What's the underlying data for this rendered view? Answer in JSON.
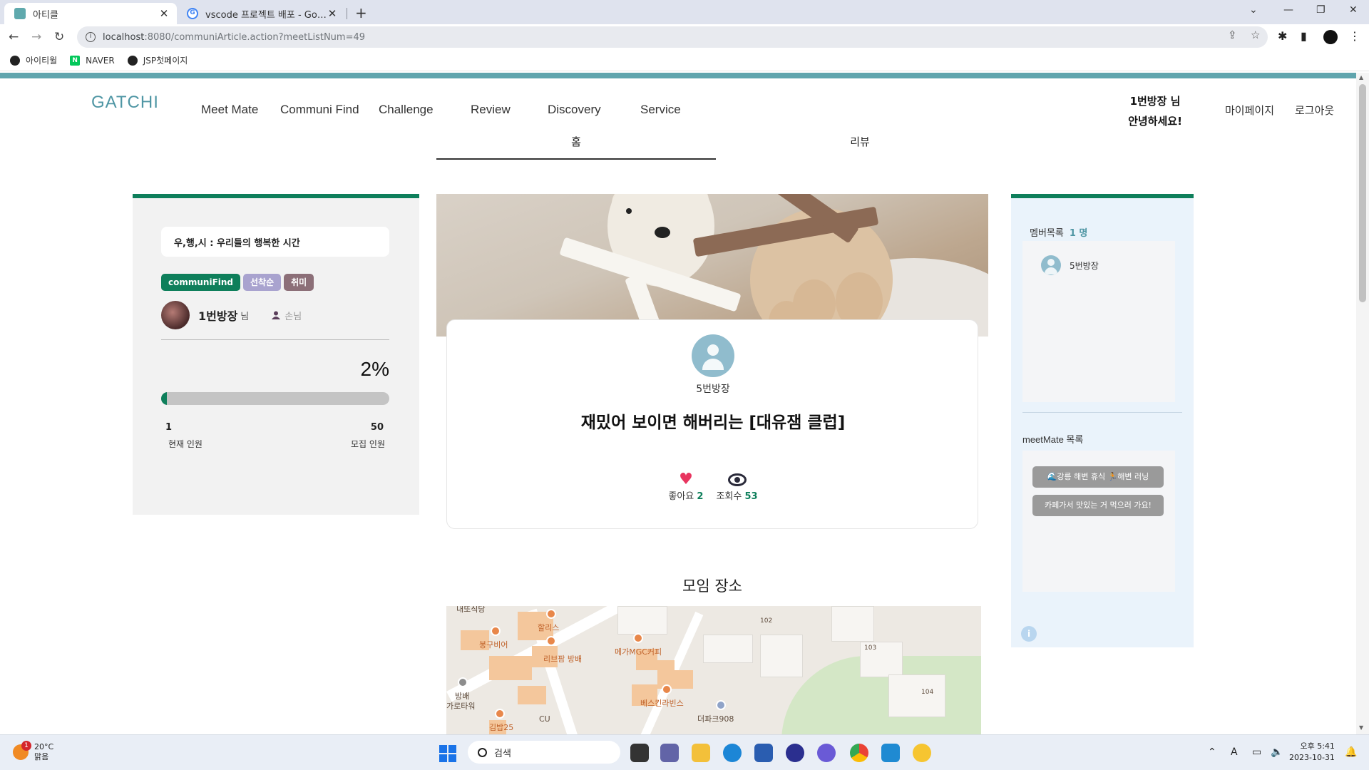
{
  "browser": {
    "tabs": [
      {
        "title": "아티클",
        "active": true
      },
      {
        "title": "vscode 프로젝트 배포 - Google",
        "active": false
      }
    ],
    "url_host": "localhost",
    "url_path": ":8080/communiArticle.action?meetListNum=49",
    "bookmarks": [
      "아이티윌",
      "NAVER",
      "JSP첫페이지"
    ],
    "naver_icon_letter": "N"
  },
  "header": {
    "logo": "GATCHI",
    "nav": [
      "Meet Mate",
      "Communi Find",
      "Challenge",
      "Review",
      "Discovery",
      "Service"
    ],
    "greeting_line1": "1번방장 님",
    "greeting_line2": "안녕하세요!",
    "mypage": "마이페이지",
    "logout": "로그아웃"
  },
  "subtabs": {
    "home": "홈",
    "review": "리뷰"
  },
  "left": {
    "title": "우,행,시 : 우리들의 행복한 시간",
    "badges": [
      "communiFind",
      "선착순",
      "취미"
    ],
    "host_name": "1번방장",
    "host_suffix": "님",
    "guest_label": "손님",
    "percent_text": "2%",
    "progress": 0.02,
    "current_count": "1",
    "max_count": "50",
    "current_label": "현재 인원",
    "max_label": "모집 인원"
  },
  "center": {
    "host_name": "5번방장",
    "title": "재밌어 보이면 해버리는 [대유잼 클럽]",
    "likes_label": "좋아요",
    "likes": "2",
    "views_label": "조회수",
    "views": "53",
    "place_title": "모임 장소",
    "map_labels": {
      "l1": "내또식당",
      "l2": "할리스",
      "l3": "봉구비어",
      "l4": "리브팜 방배",
      "l5": "메가MGC커피",
      "l6": "방배",
      "l7": "가로타워",
      "l8": "베스킨라빈스",
      "l9": "더파크908",
      "l10": "김밥25",
      "l11": "CU",
      "n102": "102",
      "n103": "103",
      "n104": "104"
    }
  },
  "right": {
    "members_label": "멤버목록",
    "members_count": "1 명",
    "members": [
      "5번방장"
    ],
    "meetmate_label": "meetMate 목록",
    "meetmates": [
      "🌊강릉 해변 휴식 🏃해변 러닝",
      "카페가서 맛있는 거 먹으러 가요!"
    ],
    "info_glyph": "i"
  },
  "taskbar": {
    "temp": "20°C",
    "weather": "맑음",
    "weather_badge": "1",
    "search": "검색",
    "time": "오후 5:41",
    "date": "2023-10-31"
  }
}
